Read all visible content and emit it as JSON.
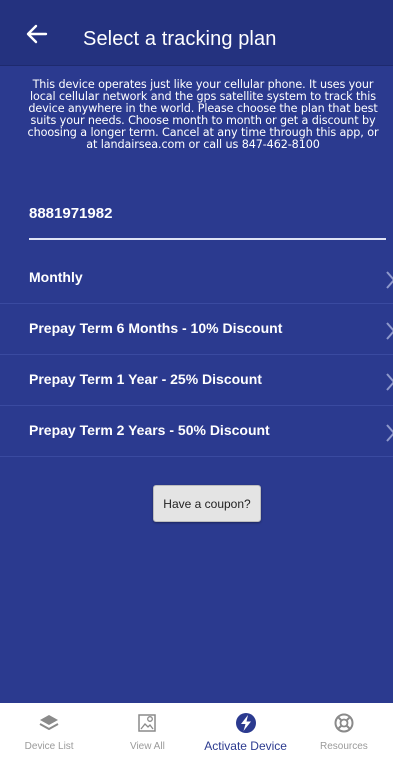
{
  "header": {
    "title": "Select a tracking plan",
    "back_icon": "arrow-left-icon"
  },
  "intro": {
    "text": "This device operates just like your cellular phone. It uses your local cellular network and the gps satellite system to track this device anywhere in the world. Please choose the plan that best suits your needs. Choose month to month or get a discount by choosing a longer term. Cancel at any time through this app, or at landairsea.com or call us 847-462-8100"
  },
  "device": {
    "id": "8881971982"
  },
  "plans": [
    {
      "label": "Monthly"
    },
    {
      "label": "Prepay Term 6 Months - 10% Discount"
    },
    {
      "label": "Prepay Term 1 Year - 25% Discount"
    },
    {
      "label": "Prepay Term 2 Years - 50% Discount"
    }
  ],
  "coupon": {
    "label": "Have a coupon?"
  },
  "bottom_nav": {
    "items": [
      {
        "label": "Device List",
        "icon": "layers-icon"
      },
      {
        "label": "View All",
        "icon": "map-icon"
      },
      {
        "label": "Activate Device",
        "icon": "bolt-icon",
        "active": true
      },
      {
        "label": "Resources",
        "icon": "lifebuoy-icon"
      }
    ]
  },
  "colors": {
    "background": "#2b3a8f",
    "header": "#24327f",
    "active_nav": "#2b3a8f"
  }
}
